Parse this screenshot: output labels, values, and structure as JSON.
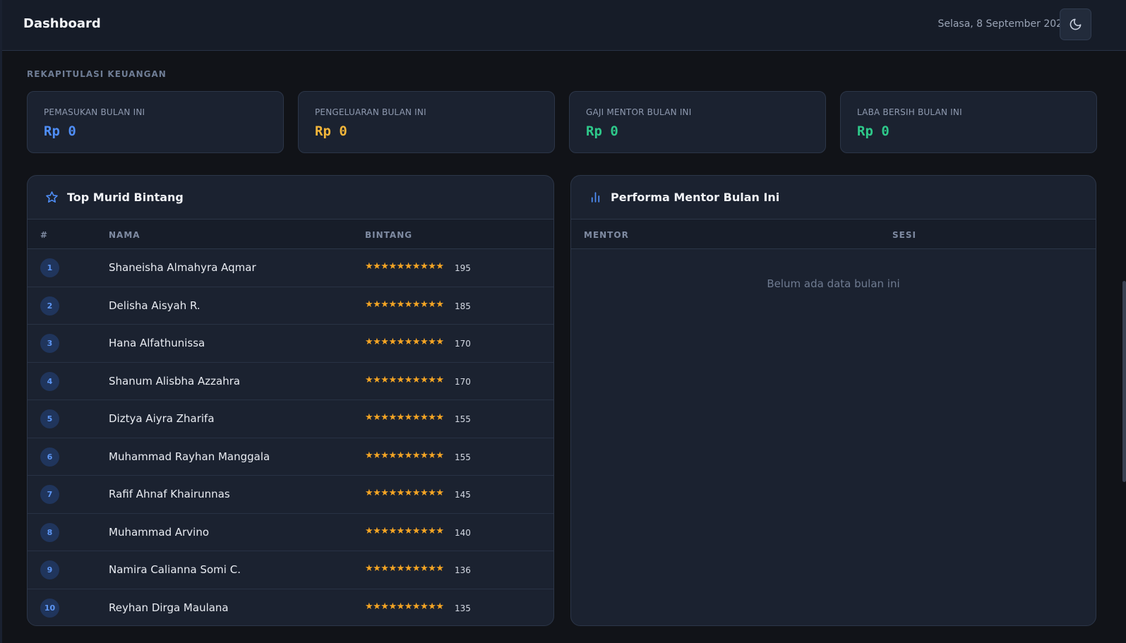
{
  "header": {
    "title": "Dashboard",
    "date": "Selasa, 8 September 2026",
    "theme_icon": "moon-icon"
  },
  "finance": {
    "section_label": "REKAPITULASI KEUANGAN",
    "cards": [
      {
        "label": "PEMASUKAN BULAN INI",
        "value": "Rp 0",
        "color": "#4f8ef7"
      },
      {
        "label": "PENGELUARAN BULAN INI",
        "value": "Rp 0",
        "color": "#f4b63a"
      },
      {
        "label": "GAJI MENTOR BULAN INI",
        "value": "Rp 0",
        "color": "#2ec98a"
      },
      {
        "label": "LABA BERSIH BULAN INI",
        "value": "Rp 0",
        "color": "#2ec98a"
      }
    ]
  },
  "top_students": {
    "title": "Top Murid Bintang",
    "icon": "star-icon",
    "columns": {
      "rank": "#",
      "name": "NAMA",
      "stars": "BINTANG"
    },
    "rows": [
      {
        "rank": "1",
        "name": "Shaneisha Almahyra Aqmar",
        "stars": "★★★★★★★★★★",
        "score": "195"
      },
      {
        "rank": "2",
        "name": "Delisha Aisyah R.",
        "stars": "★★★★★★★★★★",
        "score": "185"
      },
      {
        "rank": "3",
        "name": "Hana Alfathunissa",
        "stars": "★★★★★★★★★★",
        "score": "170"
      },
      {
        "rank": "4",
        "name": "Shanum Alisbha Azzahra",
        "stars": "★★★★★★★★★★",
        "score": "170"
      },
      {
        "rank": "5",
        "name": "Diztya Aiyra Zharifa",
        "stars": "★★★★★★★★★★",
        "score": "155"
      },
      {
        "rank": "6",
        "name": "Muhammad Rayhan Manggala",
        "stars": "★★★★★★★★★★",
        "score": "155"
      },
      {
        "rank": "7",
        "name": "Rafif Ahnaf Khairunnas",
        "stars": "★★★★★★★★★★",
        "score": "145"
      },
      {
        "rank": "8",
        "name": "Muhammad Arvino",
        "stars": "★★★★★★★★★★",
        "score": "140"
      },
      {
        "rank": "9",
        "name": "Namira Calianna Somi C.",
        "stars": "★★★★★★★★★★",
        "score": "136"
      },
      {
        "rank": "10",
        "name": "Reyhan Dirga Maulana",
        "stars": "★★★★★★★★★★",
        "score": "135"
      }
    ]
  },
  "mentor_performance": {
    "title": "Performa Mentor Bulan Ini",
    "icon": "bar-chart-icon",
    "columns": {
      "mentor": "MENTOR",
      "sessions": "SESI"
    },
    "empty_text": "Belum ada data bulan ini"
  }
}
